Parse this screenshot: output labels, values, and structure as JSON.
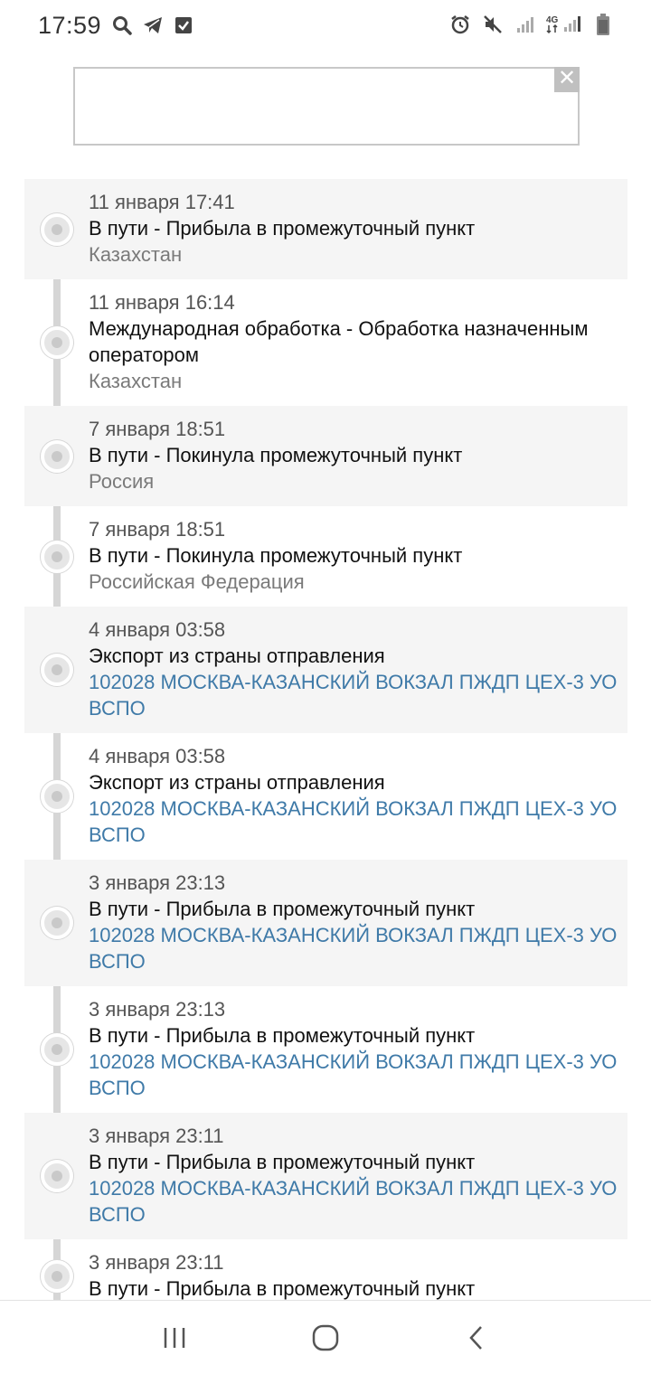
{
  "status_bar": {
    "time": "17:59",
    "network": "4G",
    "left_icons": [
      "search-icon",
      "telegram-icon",
      "checkbox-icon"
    ],
    "right_icons": [
      "alarm-icon",
      "mute-icon",
      "signal-icon",
      "signal-4g-icon",
      "battery-icon"
    ]
  },
  "ad": {
    "close_label": "✕"
  },
  "events": [
    {
      "date": "11 января 17:41",
      "status": "В пути - Прибыла в промежуточный пункт",
      "place": "Казахстан",
      "place_is_link": false
    },
    {
      "date": "11 января 16:14",
      "status": "Международная обработка - Обработка назначенным оператором",
      "place": "Казахстан",
      "place_is_link": false
    },
    {
      "date": "7 января 18:51",
      "status": "В пути - Покинула промежуточный пункт",
      "place": "Россия",
      "place_is_link": false
    },
    {
      "date": "7 января 18:51",
      "status": "В пути - Покинула промежуточный пункт",
      "place": "Российская Федерация",
      "place_is_link": false
    },
    {
      "date": "4 января 03:58",
      "status": "Экспорт из страны отправления",
      "place": "102028 МОСКВА-КАЗАНСКИЙ ВОКЗАЛ ПЖДП ЦЕХ-3 УО ВСПО",
      "place_is_link": true
    },
    {
      "date": "4 января 03:58",
      "status": "Экспорт из страны отправления",
      "place": "102028 МОСКВА-КАЗАНСКИЙ ВОКЗАЛ ПЖДП ЦЕХ-3 УО ВСПО",
      "place_is_link": true
    },
    {
      "date": "3 января 23:13",
      "status": "В пути - Прибыла в промежуточный пункт",
      "place": "102028 МОСКВА-КАЗАНСКИЙ ВОКЗАЛ ПЖДП ЦЕХ-3 УО ВСПО",
      "place_is_link": true
    },
    {
      "date": "3 января 23:13",
      "status": "В пути - Прибыла в промежуточный пункт",
      "place": "102028 МОСКВА-КАЗАНСКИЙ ВОКЗАЛ ПЖДП ЦЕХ-3 УО ВСПО",
      "place_is_link": true
    },
    {
      "date": "3 января 23:11",
      "status": "В пути - Прибыла в промежуточный пункт",
      "place": "102028 МОСКВА-КАЗАНСКИЙ ВОКЗАЛ ПЖДП ЦЕХ-3 УО ВСПО",
      "place_is_link": true
    },
    {
      "date": "3 января 23:11",
      "status": "В пути - Прибыла в промежуточный пункт",
      "place": "",
      "place_is_link": false
    }
  ],
  "nav": {
    "icons": [
      "recent-apps-icon",
      "home-icon",
      "back-icon"
    ]
  },
  "colors": {
    "link": "#3f7aa8",
    "row_shade": "#f5f5f5",
    "timeline": "#d6d6d6"
  }
}
